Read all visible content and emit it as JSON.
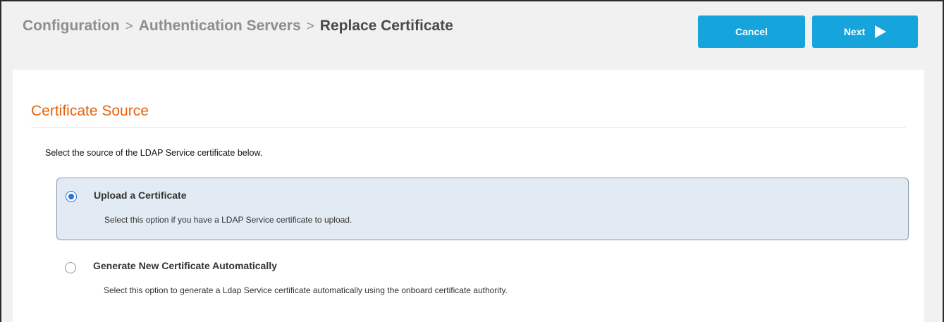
{
  "breadcrumb": {
    "items": [
      "Configuration",
      "Authentication Servers"
    ],
    "separator": ">",
    "current": "Replace Certificate"
  },
  "actions": {
    "cancel_label": "Cancel",
    "next_label": "Next"
  },
  "section": {
    "title": "Certificate Source",
    "intro": "Select the source of the LDAP Service certificate below."
  },
  "options": [
    {
      "title": "Upload a Certificate",
      "description": "Select this option if you have a LDAP Service certificate to upload.",
      "selected": true
    },
    {
      "title": "Generate New Certificate Automatically",
      "description": "Select this option to generate a Ldap Service certificate automatically using the onboard certificate authority.",
      "selected": false
    }
  ],
  "colors": {
    "accent_button": "#15a4dc",
    "section_title": "#e8640c",
    "selected_option_bg": "#e2eaf3",
    "radio_checked": "#2a73d8"
  }
}
